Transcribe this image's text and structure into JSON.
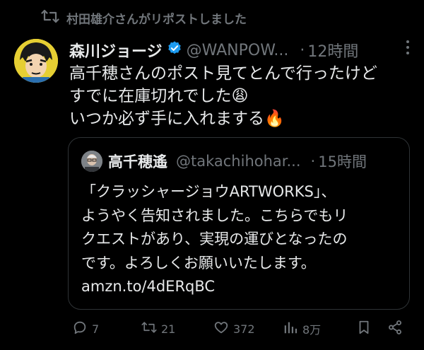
{
  "repost": {
    "text": "村田雄介さんがリポストしました"
  },
  "tweet": {
    "author_name": "森川ジョージ",
    "handle": "@WANPOW...",
    "separator": "·",
    "time": "12時間",
    "more": "···",
    "lines": [
      "高千穂さんのポスト見てとんで行ったけど",
      "すでに在庫切れでした😩",
      "いつか必ず手に入れまする🔥"
    ]
  },
  "quote": {
    "author_name": "高千穂遙",
    "handle": "@takachihohar...",
    "separator": "·",
    "time": "15時間",
    "lines": [
      "「クラッシャージョウARTWORKS」、",
      "ようやく告知されました。こちらでもリ",
      "クエストがあり、実現の運びとなったの",
      "です。よろしくお願いいたします。",
      "amzn.to/4dERqBC"
    ]
  },
  "actions": {
    "replies": "7",
    "reposts": "21",
    "likes": "372",
    "views": "8万"
  },
  "colors": {
    "background": "#000000",
    "text": "#e7e9ea",
    "muted": "#71767b",
    "verified": "#1d9bf0",
    "border": "#2f3336"
  }
}
